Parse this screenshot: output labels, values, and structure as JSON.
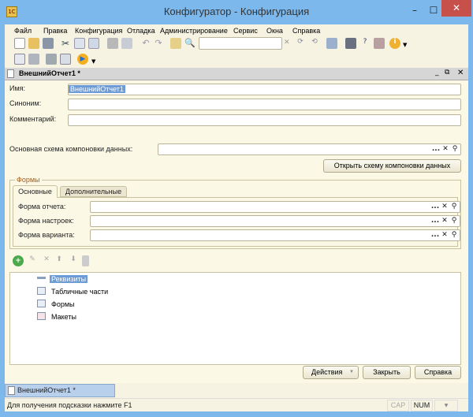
{
  "window": {
    "title": "Конфигуратор - Конфигурация",
    "app_icon": "1C"
  },
  "menu": [
    "Файл",
    "Правка",
    "Конфигурация",
    "Отладка",
    "Администрирование",
    "Сервис",
    "Окна",
    "Справка"
  ],
  "toolbar": {
    "search_value": ""
  },
  "document": {
    "title": "ВнешнийОтчет1 *",
    "fields": {
      "name_label": "Имя:",
      "name_value": "ВнешнийОтчет1",
      "synonym_label": "Синоним:",
      "synonym_value": "",
      "comment_label": "Комментарий:",
      "comment_value": "",
      "schema_label": "Основная схема компоновки данных:",
      "schema_value": ""
    },
    "open_schema_button": "Открыть схему компоновки данных",
    "forms_group": {
      "title": "Формы",
      "tabs": [
        "Основные",
        "Дополнительные"
      ],
      "active_tab": "Основные",
      "report_form_label": "Форма отчета:",
      "settings_form_label": "Форма настроек:",
      "variant_form_label": "Форма варианта:"
    },
    "tree": [
      {
        "label": "Реквизиты",
        "selected": true,
        "icon": "attribute-icon"
      },
      {
        "label": "Табличные части",
        "icon": "table-icon"
      },
      {
        "label": "Формы",
        "icon": "form-icon"
      },
      {
        "label": "Макеты",
        "icon": "template-icon"
      }
    ],
    "buttons": {
      "actions": "Действия",
      "close": "Закрыть",
      "help": "Справка"
    }
  },
  "taskbar": {
    "tab": "ВнешнийОтчет1 *"
  },
  "status": {
    "hint": "Для получения подсказки нажмите F1",
    "cap": "CAP",
    "num": "NUM"
  },
  "colors": {
    "frame": "#7cb8ec",
    "close": "#c7504a",
    "selection": "#6d9bd5",
    "pane": "#fbf8e6"
  }
}
